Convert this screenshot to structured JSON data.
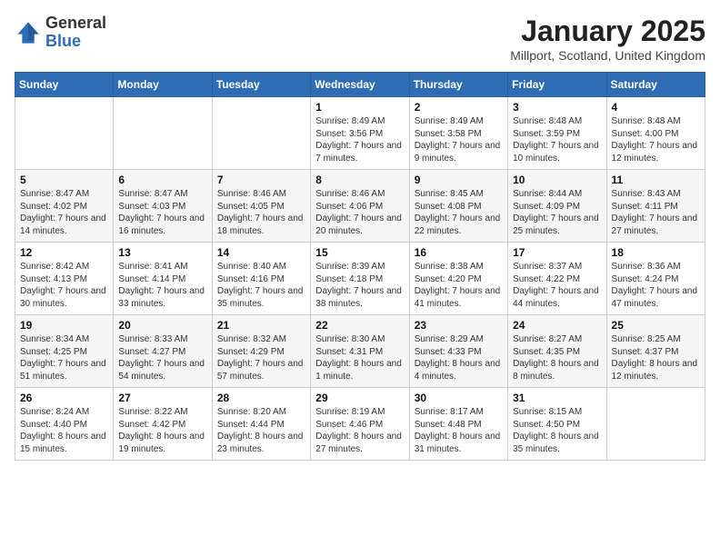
{
  "logo": {
    "general": "General",
    "blue": "Blue"
  },
  "title": "January 2025",
  "subtitle": "Millport, Scotland, United Kingdom",
  "weekdays": [
    "Sunday",
    "Monday",
    "Tuesday",
    "Wednesday",
    "Thursday",
    "Friday",
    "Saturday"
  ],
  "weeks": [
    [
      {
        "day": "",
        "sunrise": "",
        "sunset": "",
        "daylight": ""
      },
      {
        "day": "",
        "sunrise": "",
        "sunset": "",
        "daylight": ""
      },
      {
        "day": "",
        "sunrise": "",
        "sunset": "",
        "daylight": ""
      },
      {
        "day": "1",
        "sunrise": "Sunrise: 8:49 AM",
        "sunset": "Sunset: 3:56 PM",
        "daylight": "Daylight: 7 hours and 7 minutes."
      },
      {
        "day": "2",
        "sunrise": "Sunrise: 8:49 AM",
        "sunset": "Sunset: 3:58 PM",
        "daylight": "Daylight: 7 hours and 9 minutes."
      },
      {
        "day": "3",
        "sunrise": "Sunrise: 8:48 AM",
        "sunset": "Sunset: 3:59 PM",
        "daylight": "Daylight: 7 hours and 10 minutes."
      },
      {
        "day": "4",
        "sunrise": "Sunrise: 8:48 AM",
        "sunset": "Sunset: 4:00 PM",
        "daylight": "Daylight: 7 hours and 12 minutes."
      }
    ],
    [
      {
        "day": "5",
        "sunrise": "Sunrise: 8:47 AM",
        "sunset": "Sunset: 4:02 PM",
        "daylight": "Daylight: 7 hours and 14 minutes."
      },
      {
        "day": "6",
        "sunrise": "Sunrise: 8:47 AM",
        "sunset": "Sunset: 4:03 PM",
        "daylight": "Daylight: 7 hours and 16 minutes."
      },
      {
        "day": "7",
        "sunrise": "Sunrise: 8:46 AM",
        "sunset": "Sunset: 4:05 PM",
        "daylight": "Daylight: 7 hours and 18 minutes."
      },
      {
        "day": "8",
        "sunrise": "Sunrise: 8:46 AM",
        "sunset": "Sunset: 4:06 PM",
        "daylight": "Daylight: 7 hours and 20 minutes."
      },
      {
        "day": "9",
        "sunrise": "Sunrise: 8:45 AM",
        "sunset": "Sunset: 4:08 PM",
        "daylight": "Daylight: 7 hours and 22 minutes."
      },
      {
        "day": "10",
        "sunrise": "Sunrise: 8:44 AM",
        "sunset": "Sunset: 4:09 PM",
        "daylight": "Daylight: 7 hours and 25 minutes."
      },
      {
        "day": "11",
        "sunrise": "Sunrise: 8:43 AM",
        "sunset": "Sunset: 4:11 PM",
        "daylight": "Daylight: 7 hours and 27 minutes."
      }
    ],
    [
      {
        "day": "12",
        "sunrise": "Sunrise: 8:42 AM",
        "sunset": "Sunset: 4:13 PM",
        "daylight": "Daylight: 7 hours and 30 minutes."
      },
      {
        "day": "13",
        "sunrise": "Sunrise: 8:41 AM",
        "sunset": "Sunset: 4:14 PM",
        "daylight": "Daylight: 7 hours and 33 minutes."
      },
      {
        "day": "14",
        "sunrise": "Sunrise: 8:40 AM",
        "sunset": "Sunset: 4:16 PM",
        "daylight": "Daylight: 7 hours and 35 minutes."
      },
      {
        "day": "15",
        "sunrise": "Sunrise: 8:39 AM",
        "sunset": "Sunset: 4:18 PM",
        "daylight": "Daylight: 7 hours and 38 minutes."
      },
      {
        "day": "16",
        "sunrise": "Sunrise: 8:38 AM",
        "sunset": "Sunset: 4:20 PM",
        "daylight": "Daylight: 7 hours and 41 minutes."
      },
      {
        "day": "17",
        "sunrise": "Sunrise: 8:37 AM",
        "sunset": "Sunset: 4:22 PM",
        "daylight": "Daylight: 7 hours and 44 minutes."
      },
      {
        "day": "18",
        "sunrise": "Sunrise: 8:36 AM",
        "sunset": "Sunset: 4:24 PM",
        "daylight": "Daylight: 7 hours and 47 minutes."
      }
    ],
    [
      {
        "day": "19",
        "sunrise": "Sunrise: 8:34 AM",
        "sunset": "Sunset: 4:25 PM",
        "daylight": "Daylight: 7 hours and 51 minutes."
      },
      {
        "day": "20",
        "sunrise": "Sunrise: 8:33 AM",
        "sunset": "Sunset: 4:27 PM",
        "daylight": "Daylight: 7 hours and 54 minutes."
      },
      {
        "day": "21",
        "sunrise": "Sunrise: 8:32 AM",
        "sunset": "Sunset: 4:29 PM",
        "daylight": "Daylight: 7 hours and 57 minutes."
      },
      {
        "day": "22",
        "sunrise": "Sunrise: 8:30 AM",
        "sunset": "Sunset: 4:31 PM",
        "daylight": "Daylight: 8 hours and 1 minute."
      },
      {
        "day": "23",
        "sunrise": "Sunrise: 8:29 AM",
        "sunset": "Sunset: 4:33 PM",
        "daylight": "Daylight: 8 hours and 4 minutes."
      },
      {
        "day": "24",
        "sunrise": "Sunrise: 8:27 AM",
        "sunset": "Sunset: 4:35 PM",
        "daylight": "Daylight: 8 hours and 8 minutes."
      },
      {
        "day": "25",
        "sunrise": "Sunrise: 8:25 AM",
        "sunset": "Sunset: 4:37 PM",
        "daylight": "Daylight: 8 hours and 12 minutes."
      }
    ],
    [
      {
        "day": "26",
        "sunrise": "Sunrise: 8:24 AM",
        "sunset": "Sunset: 4:40 PM",
        "daylight": "Daylight: 8 hours and 15 minutes."
      },
      {
        "day": "27",
        "sunrise": "Sunrise: 8:22 AM",
        "sunset": "Sunset: 4:42 PM",
        "daylight": "Daylight: 8 hours and 19 minutes."
      },
      {
        "day": "28",
        "sunrise": "Sunrise: 8:20 AM",
        "sunset": "Sunset: 4:44 PM",
        "daylight": "Daylight: 8 hours and 23 minutes."
      },
      {
        "day": "29",
        "sunrise": "Sunrise: 8:19 AM",
        "sunset": "Sunset: 4:46 PM",
        "daylight": "Daylight: 8 hours and 27 minutes."
      },
      {
        "day": "30",
        "sunrise": "Sunrise: 8:17 AM",
        "sunset": "Sunset: 4:48 PM",
        "daylight": "Daylight: 8 hours and 31 minutes."
      },
      {
        "day": "31",
        "sunrise": "Sunrise: 8:15 AM",
        "sunset": "Sunset: 4:50 PM",
        "daylight": "Daylight: 8 hours and 35 minutes."
      },
      {
        "day": "",
        "sunrise": "",
        "sunset": "",
        "daylight": ""
      }
    ]
  ]
}
